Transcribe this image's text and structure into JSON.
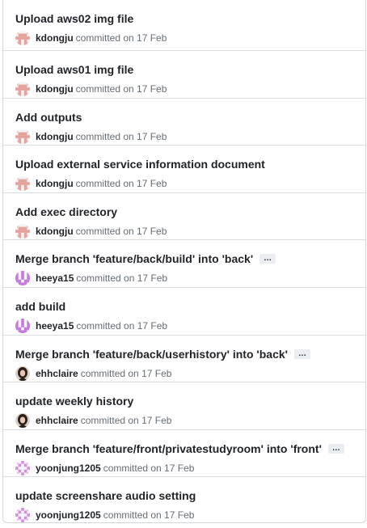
{
  "commits": [
    {
      "title": "Upload aws02 img file",
      "author": "kdongju",
      "committed_text": "committed on 17 Feb",
      "avatar": "kdongju-identicon",
      "has_ellipsis": false
    },
    {
      "title": "Upload aws01 img file",
      "author": "kdongju",
      "committed_text": "committed on 17 Feb",
      "avatar": "kdongju-identicon",
      "has_ellipsis": false
    },
    {
      "title": "Add outputs",
      "author": "kdongju",
      "committed_text": "committed on 17 Feb",
      "avatar": "kdongju-identicon",
      "has_ellipsis": false
    },
    {
      "title": "Upload external service information document",
      "author": "kdongju",
      "committed_text": "committed on 17 Feb",
      "avatar": "kdongju-identicon",
      "has_ellipsis": false
    },
    {
      "title": "Add exec directory",
      "author": "kdongju",
      "committed_text": "committed on 17 Feb",
      "avatar": "kdongju-identicon",
      "has_ellipsis": false
    },
    {
      "title": "Merge branch 'feature/back/build' into 'back'",
      "author": "heeya15",
      "committed_text": "committed on 17 Feb",
      "avatar": "heeya15-identicon",
      "has_ellipsis": true,
      "ellipsis": "…"
    },
    {
      "title": "add build",
      "author": "heeya15",
      "committed_text": "committed on 17 Feb",
      "avatar": "heeya15-identicon",
      "has_ellipsis": false
    },
    {
      "title": "Merge branch 'feature/back/userhistory' into 'back'",
      "author": "ehhclaire",
      "committed_text": "committed on 17 Feb",
      "avatar": "ehhclaire-photo",
      "has_ellipsis": true,
      "ellipsis": "…"
    },
    {
      "title": "update weekly history",
      "author": "ehhclaire",
      "committed_text": "committed on 17 Feb",
      "avatar": "ehhclaire-photo",
      "has_ellipsis": false
    },
    {
      "title": "Merge branch 'feature/front/privatestudyroom' into 'front'",
      "author": "yoonjung1205",
      "committed_text": "committed on 17 Feb",
      "avatar": "yoonjung1205-identicon",
      "has_ellipsis": true,
      "ellipsis": "…"
    },
    {
      "title": "update screenshare audio setting",
      "author": "yoonjung1205",
      "committed_text": "committed on 17 Feb",
      "avatar": "yoonjung1205-identicon",
      "has_ellipsis": false
    }
  ],
  "colors": {
    "kdongju": "#e4a29a",
    "heeya15": "#c57bdc",
    "yoonjung1205": "#d68be0",
    "ehhclaire_bg": "#8a6e5c"
  }
}
